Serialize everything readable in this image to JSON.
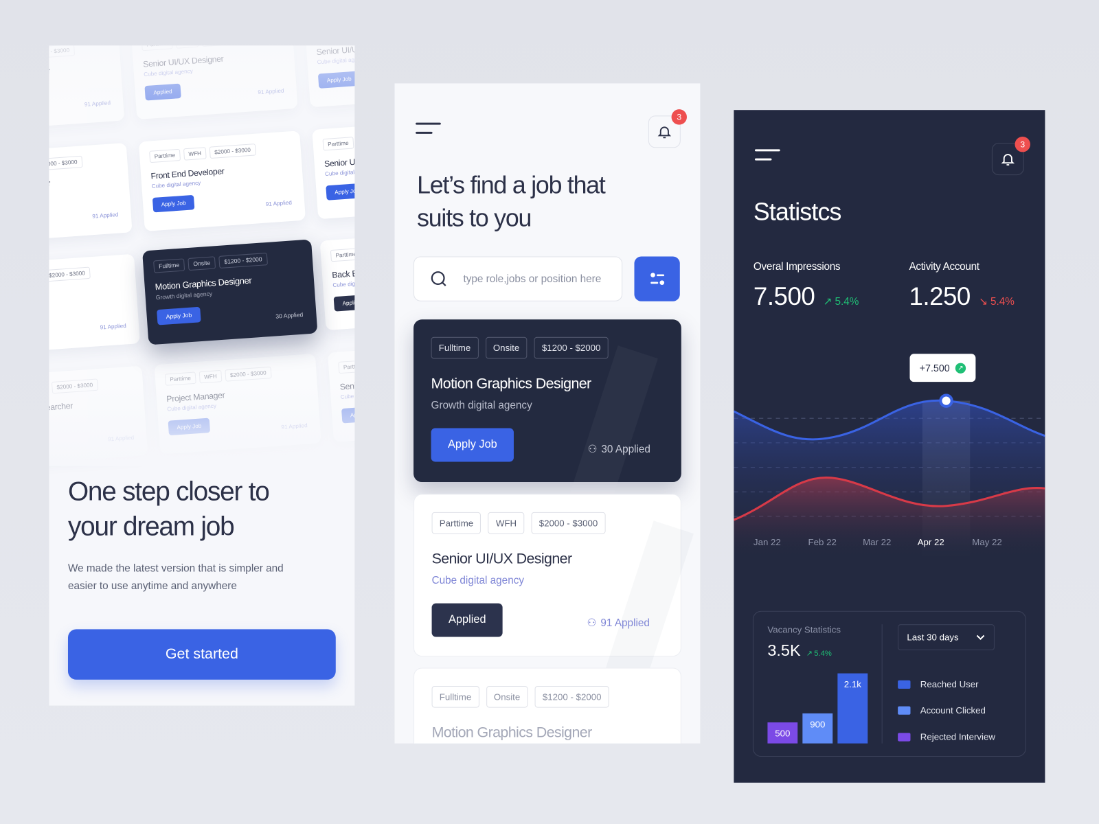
{
  "onboarding": {
    "collage_cards": [
      {
        "tags": [
          "Parttime",
          "WFH",
          "$2000 - $3000"
        ],
        "title": "Senior UI/UX Designer",
        "company": "Cube digital agency",
        "button": "Apply Job",
        "applied": "91 Applied",
        "style": "faded"
      },
      {
        "tags": [
          "Parttime",
          "WFH",
          "$2000 - $3000"
        ],
        "title": "Senior UI/UX Designer",
        "company": "Cube digital agency",
        "button": "Applied",
        "applied": "91 Applied",
        "style": "faded"
      },
      {
        "tags": [
          "Parttime",
          "WFH",
          "$2000 - $3000"
        ],
        "title": "Senior UI/UX Designer",
        "company": "Cube digital agency",
        "button": "Apply Job",
        "applied": "91 Applied",
        "style": "faded"
      },
      {
        "tags": [
          "Parttime",
          "WFH",
          "$2000 - $3000"
        ],
        "title": "Back End Developer",
        "company": "Cube digital agency",
        "button": "Applied",
        "applied": "91 Applied",
        "style": "applied"
      },
      {
        "tags": [
          "Parttime",
          "WFH",
          "$2000 - $3000"
        ],
        "title": "Front End Developer",
        "company": "Cube digital agency",
        "button": "Apply Job",
        "applied": "91 Applied",
        "style": "normal"
      },
      {
        "tags": [
          "Parttime",
          "WFH",
          "$2000 - $3000"
        ],
        "title": "Senior UI/UX Designer",
        "company": "Cube digital agency",
        "button": "Apply Job",
        "applied": "91 Applied",
        "style": "normal"
      },
      {
        "tags": [
          "Parttime",
          "WFH",
          "$2000 - $3000"
        ],
        "title": "Product Designer",
        "company": "Cube digital agency",
        "button": "Apply Job",
        "applied": "91 Applied",
        "style": "normal"
      },
      {
        "tags": [
          "Fulltime",
          "Onsite",
          "$1200 - $2000"
        ],
        "title": "Motion Graphics Designer",
        "company": "Growth digital agency",
        "button": "Apply Job",
        "applied": "30 Applied",
        "style": "dark"
      },
      {
        "tags": [
          "Parttime",
          "WFH",
          "$2000 - $3000"
        ],
        "title": "Back End Developer",
        "company": "Cube digital agency",
        "button": "Applied",
        "applied": "91 Applied",
        "style": "applied"
      },
      {
        "tags": [
          "Parttime",
          "WFH",
          "$2000 - $3000"
        ],
        "title": "Senior UX Researcher",
        "company": "Cube digital agency",
        "button": "Apply Job",
        "applied": "91 Applied",
        "style": "faded"
      },
      {
        "tags": [
          "Parttime",
          "WFH",
          "$2000 - $3000"
        ],
        "title": "Project Manager",
        "company": "Cube digital agency",
        "button": "Apply Job",
        "applied": "91 Applied",
        "style": "faded"
      },
      {
        "tags": [
          "Parttime",
          "WFH",
          "$2000 - $3000"
        ],
        "title": "Senior UI/UX Designer",
        "company": "Cube digital agency",
        "button": "Apply Job",
        "applied": "91 Applied",
        "style": "faded"
      }
    ],
    "headline": "One step closer to your dream job",
    "description": "We made the latest version that is simpler and easier to use anytime and anywhere",
    "cta": "Get started"
  },
  "jobs": {
    "notification_count": "3",
    "headline": "Let’s find a job that suits to you",
    "search_placeholder": "type role,jobs or position here",
    "cards": [
      {
        "tags": [
          "Fulltime",
          "Onsite",
          "$1200 - $2000"
        ],
        "title": "Motion Graphics Designer",
        "company": "Growth digital agency",
        "button": "Apply Job",
        "applied": "30 Applied"
      },
      {
        "tags": [
          "Parttime",
          "WFH",
          "$2000 - $3000"
        ],
        "title": "Senior UI/UX Designer",
        "company": "Cube digital agency",
        "button": "Applied",
        "applied": "91 Applied"
      },
      {
        "tags": [
          "Fulltime",
          "Onsite",
          "$1200 - $2000"
        ],
        "title": "Motion Graphics Designer"
      }
    ]
  },
  "stats": {
    "notification_count": "3",
    "title": "Statistcs",
    "impressions": {
      "label": "Overal Impressions",
      "value": "7.500",
      "change": "5.4%",
      "direction": "up"
    },
    "activity": {
      "label": "Activity Account",
      "value": "1.250",
      "change": "5.4%",
      "direction": "down"
    },
    "tooltip": "+7.500",
    "months": [
      "Jan 22",
      "Feb 22",
      "Mar 22",
      "Apr 22",
      "May 22"
    ],
    "active_month": "Apr 22",
    "vacancy": {
      "label": "Vacancy Statistics",
      "value": "3.5K",
      "change": "5.4%",
      "range": "Last 30 days"
    },
    "colors": {
      "up": "#1fbf75",
      "down": "#ee4f4f",
      "accent": "#3a63e4"
    }
  },
  "chart_data": {
    "type": "bar",
    "title": "Vacancy Statistics",
    "categories": [
      "Rejected Interview",
      "Account Clicked",
      "Reached User"
    ],
    "values": [
      500,
      900,
      2100
    ],
    "value_labels": [
      "500",
      "900",
      "2.1k"
    ],
    "colors": [
      "#7b4ae6",
      "#5f8cf7",
      "#3a63e4"
    ],
    "legend": [
      "Reached User",
      "Account Clicked",
      "Rejected Interview"
    ],
    "legend_placement": "right"
  }
}
